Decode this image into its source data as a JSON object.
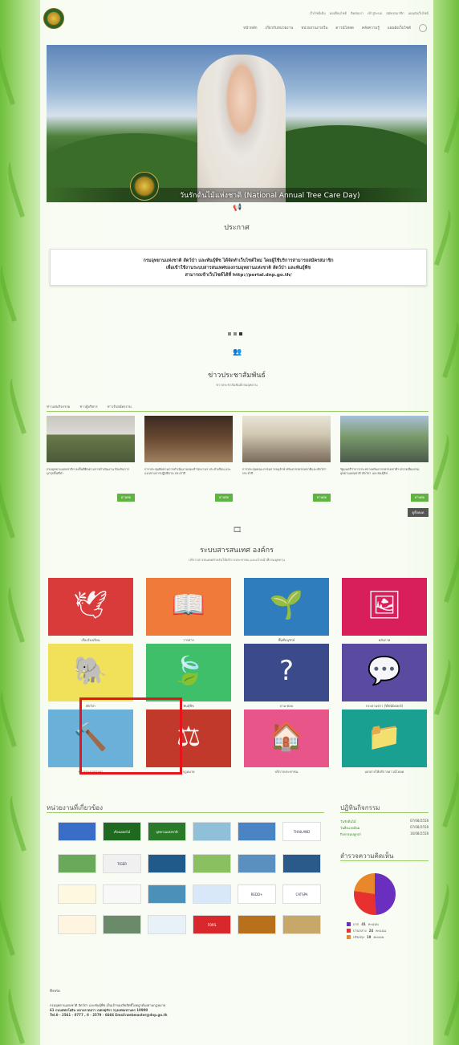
{
  "header": {
    "top_links": [
      "เว็บไซต์เดิม",
      "ผลเพื่อนไซต์",
      "ติดต่อเรา",
      "เข้าสู่ระบบ",
      "สมัครสมาชิก",
      "แผนผังเว็บไซต์"
    ],
    "nav": [
      "หน้าหลัก",
      "เกี่ยวกับหน่วยงาน",
      "หน่วยงานภายใน",
      "ดาวน์โหลด",
      "คลังความรู้",
      "แผนผังเว็บไซต์"
    ]
  },
  "hero": {
    "caption": "วันรักต้นไม้แห่งชาติ (National Annual Tree Care Day)"
  },
  "announcement": {
    "title": "ประกาศ",
    "lines": [
      "กรมอุทยานแห่งชาติ สัตว์ป่า และพันธุ์พืช ได้จัดทำเว็บไซต์ใหม่ โดยผู้ใช้บริการสามารถสมัครสมาชิก",
      "เพื่อเข้าใช้งานระบบสารสนเทศของกรมอุทยานแห่งชาติ สัตว์ป่า และพันธุ์พืช",
      "สามารถเข้าเว็บไซต์ได้ที่ http://portal.dnp.go.th/"
    ]
  },
  "news": {
    "title": "ข่าวประชาสัมพันธ์",
    "subtitle": "ข่าวประชาสัมพันธ์กรมอุทยาน",
    "tabs": [
      "ข่าวเด่นกิจกรรม",
      "ข่าวผู้บริหาร",
      "ข่าวรับสมัครงาน"
    ],
    "items": [
      {
        "text": "กรมอุทยานแห่งชาติฯ ลงพื้นที่ติดตามการดำเนินงาน ป้องกันการบุกรุกพื้นที่ป่า"
      },
      {
        "text": "การประชุมติดตามการดำเนินงานของสำนักงานฯ ประจำเดือน และแนวทางการปฏิบัติงาน ประจำปี"
      },
      {
        "text": "การประชุมคณะกรรมการอนุรักษ์ ทรัพยากรธรรมชาติและสัตว์ป่า ประจำปี"
      },
      {
        "text": "รัฐมนตรีว่าการกระทรวงทรัพยากรธรรมชาติฯ ตรวจเยี่ยมกรมอุทยานแห่งชาติ สัตว์ป่า และพันธุ์พืช"
      }
    ],
    "read_more": "อ่านต่อ",
    "all": "ดูทั้งหมด"
  },
  "systems": {
    "title": "ระบบสารสนเทศ องค์กร",
    "subtitle": "บริการสารสนเทศสำหรับให้บริการประชาชน และเจ้าหน้าที่กรมอุทยาน",
    "tiles": [
      {
        "label": "เรื่องร้องเรียน",
        "color": "#d93a3a",
        "icon": "dove-icon",
        "glyph": "🕊"
      },
      {
        "label": "วารสาร",
        "color": "#f07a3a",
        "icon": "book-icon",
        "glyph": "📖"
      },
      {
        "label": "พื้นที่อนุรักษ์",
        "color": "#2f7dbd",
        "icon": "plant-icon",
        "glyph": "🌱"
      },
      {
        "label": "คลังภาพ",
        "color": "#d81e5b",
        "icon": "picture-icon",
        "glyph": "🖼"
      },
      {
        "label": "สัตว์ป่า",
        "color": "#f0e05a",
        "icon": "elephant-icon",
        "glyph": "🐘"
      },
      {
        "label": "พันธุ์พืช",
        "color": "#3fbf6a",
        "icon": "leaves-icon",
        "glyph": "🍃"
      },
      {
        "label": "ถาม-ตอบ",
        "color": "#3b4a8a",
        "icon": "question-icon",
        "glyph": "?"
      },
      {
        "label": "กระดานข่าว (Webboard)",
        "color": "#5a4aa0",
        "icon": "webboard-icon",
        "glyph": "💬"
      },
      {
        "label": "ข่าวประกวดราคา",
        "color": "#6ab0d8",
        "icon": "gavel-icon",
        "glyph": "🔨"
      },
      {
        "label": "กฎหมาย",
        "color": "#c0392b",
        "icon": "scales-icon",
        "glyph": "⚖"
      },
      {
        "label": "บริการประชาชน",
        "color": "#e8558a",
        "icon": "door-hanger-icon",
        "glyph": "🏠"
      },
      {
        "label": "เอกสารให้บริการดาวน์โหลด",
        "color": "#1aa090",
        "icon": "folder-icon",
        "glyph": "📁"
      }
    ]
  },
  "related": {
    "title": "หน่วยงานที่เกี่ยวข้อง",
    "logos": [
      {
        "name": "kasikorn",
        "color": "#3a6dc8",
        "text": ""
      },
      {
        "name": "dnp-green",
        "color": "#1f6a1f",
        "text": "เรือนยอดไม้"
      },
      {
        "name": "dnp-green2",
        "color": "#2a7a2a",
        "text": "อุทยานแห่งชาติ"
      },
      {
        "name": "forest-project",
        "color": "#8fc0d8",
        "text": ""
      },
      {
        "name": "blue-banner",
        "color": "#4a84c4",
        "text": ""
      },
      {
        "name": "amazing-thailand",
        "color": "#ffffff",
        "text": "THAILAND"
      },
      {
        "name": "wildlife",
        "color": "#6aa85a",
        "text": ""
      },
      {
        "name": "tiger",
        "color": "#f0f0f0",
        "text": "TIGER"
      },
      {
        "name": "dnp-seal",
        "color": "#1f5a8a",
        "text": ""
      },
      {
        "name": "forest-fire",
        "color": "#8ac060",
        "text": ""
      },
      {
        "name": "landscape",
        "color": "#5a90c0",
        "text": ""
      },
      {
        "name": "botanic",
        "color": "#2a5a8a",
        "text": ""
      },
      {
        "name": "nationalpark-yellow",
        "color": "#fff8e0",
        "text": ""
      },
      {
        "name": "dnp-white",
        "color": "#f8f8f8",
        "text": ""
      },
      {
        "name": "lake",
        "color": "#4a90b8",
        "text": ""
      },
      {
        "name": "dnp-blue",
        "color": "#d8e8f8",
        "text": ""
      },
      {
        "name": "redd",
        "color": "#ffffff",
        "text": "REDD+"
      },
      {
        "name": "catspa",
        "color": "#ffffff",
        "text": "CATSPA"
      },
      {
        "name": "forest-knowledge",
        "color": "#fff4e0",
        "text": ""
      },
      {
        "name": "photo-forest",
        "color": "#6a8a6a",
        "text": ""
      },
      {
        "name": "blue-white",
        "color": "#e8f0f8",
        "text": ""
      },
      {
        "name": "fors",
        "color": "#d8282c",
        "text": "FORS"
      },
      {
        "name": "fire-forest",
        "color": "#b8701a",
        "text": ""
      },
      {
        "name": "deer",
        "color": "#c8a868",
        "text": ""
      }
    ]
  },
  "calendar": {
    "title": "ปฏิทินกิจกรรม",
    "events": [
      {
        "name": "วันรักต้นไม้",
        "date": "07/08/2558"
      },
      {
        "name": "วันสิ่งแวดล้อม",
        "date": "07/08/2558"
      },
      {
        "name": "กิจกรรมปลูกป่า",
        "date": "16/08/2558"
      }
    ]
  },
  "poll": {
    "title": "สำรวจความคิดเห็น",
    "results": [
      {
        "label": "มาก",
        "value": 41,
        "unit": "คะแนน",
        "color": "#6a2fbf"
      },
      {
        "label": "ปานกลาง",
        "value": 24,
        "unit": "คะแนน",
        "color": "#e83030"
      },
      {
        "label": "ปรับปรุง",
        "value": 19,
        "unit": "คะแนน",
        "color": "#e8882a"
      }
    ]
  },
  "footer": {
    "title": "ติดต่อ",
    "lines": [
      "กรมอุทยานแห่งชาติ สัตว์ป่า และพันธุ์พืช เป็นเจ้าของลิขสิทธิ์โดยถูกต้องตามกฎหมาย",
      "61 ถนนพหลโยธิน แขวงลาดยาว เขตจตุจักร กรุงเทพมหานคร 10900",
      "Tel.0 - 2561 - 0777 , 0 - 2579 - 6666 Email:webmaster@dnp.go.th"
    ]
  }
}
